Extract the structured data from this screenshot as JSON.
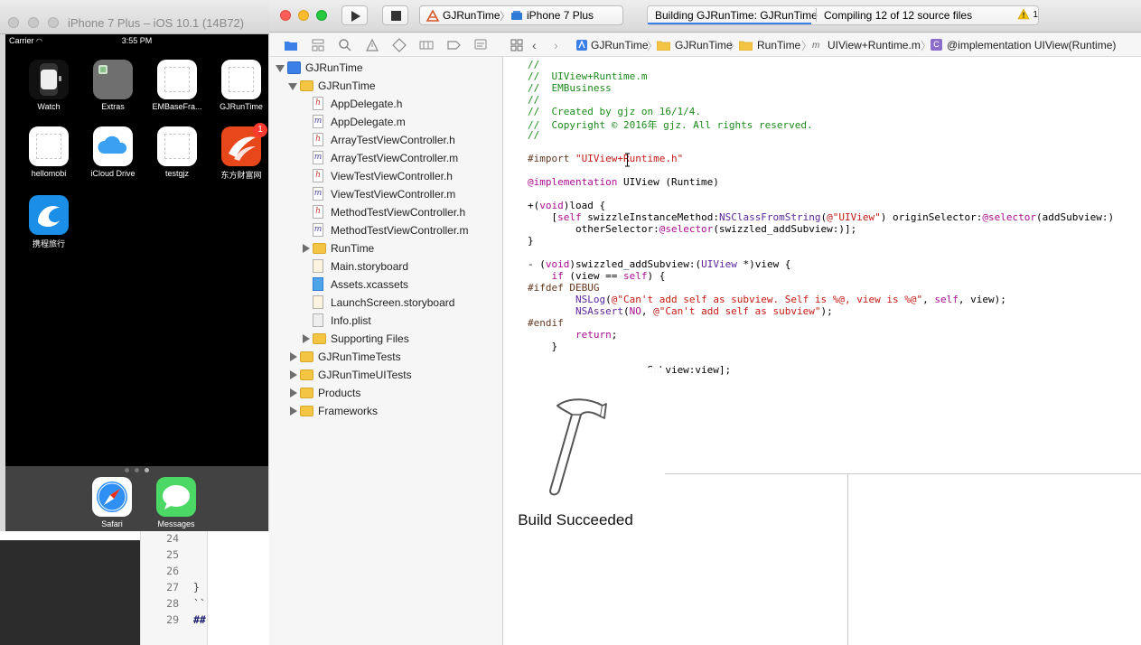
{
  "simulator": {
    "window_title": "iPhone 7 Plus – iOS 10.1 (14B72)",
    "status_bar": {
      "carrier": "Carrier",
      "time": "3:55 PM"
    },
    "home_apps": [
      {
        "label": "Watch",
        "icon": "watch-icon"
      },
      {
        "label": "Extras",
        "icon": "folder-icon"
      },
      {
        "label": "EMBaseFra...",
        "icon": "blank-app-icon"
      },
      {
        "label": "GJRunTime",
        "icon": "blank-app-icon"
      },
      {
        "label": "hellomobi",
        "icon": "blank-app-icon"
      },
      {
        "label": "iCloud Drive",
        "icon": "cloud-icon"
      },
      {
        "label": "testgjz",
        "icon": "blank-app-icon"
      },
      {
        "label": "东方财富网",
        "icon": "eastmoney-icon",
        "badge": "1"
      },
      {
        "label": "携程旅行",
        "icon": "dolphin-icon"
      }
    ],
    "dock_apps": [
      {
        "label": "Safari",
        "icon": "compass-icon"
      },
      {
        "label": "Messages",
        "icon": "speech-bubble-icon"
      }
    ],
    "background_editor": {
      "line_numbers": [
        "24",
        "25",
        "26",
        "27",
        "28",
        "29"
      ],
      "code": [
        "",
        "",
        "",
        "}",
        "``",
        "##"
      ]
    }
  },
  "toolbar": {
    "scheme": "GJRunTime",
    "device": "iPhone 7 Plus",
    "activity_title": "Building GJRunTime: GJRunTime",
    "activity_status": "Compiling 12 of 12 source files",
    "warning_count": "1",
    "build_progress": 0.42
  },
  "navigator": {
    "tree": [
      {
        "label": "GJRunTime",
        "depth": 0,
        "kind": "project",
        "disclosure": "open"
      },
      {
        "label": "GJRunTime",
        "depth": 1,
        "kind": "folder",
        "disclosure": "open"
      },
      {
        "label": "AppDelegate.h",
        "depth": 2,
        "kind": "h"
      },
      {
        "label": "AppDelegate.m",
        "depth": 2,
        "kind": "m"
      },
      {
        "label": "ArrayTestViewController.h",
        "depth": 2,
        "kind": "h"
      },
      {
        "label": "ArrayTestViewController.m",
        "depth": 2,
        "kind": "m"
      },
      {
        "label": "ViewTestViewController.h",
        "depth": 2,
        "kind": "h"
      },
      {
        "label": "ViewTestViewController.m",
        "depth": 2,
        "kind": "m"
      },
      {
        "label": "MethodTestViewController.h",
        "depth": 2,
        "kind": "h"
      },
      {
        "label": "MethodTestViewController.m",
        "depth": 2,
        "kind": "m"
      },
      {
        "label": "RunTime",
        "depth": 2,
        "kind": "folder",
        "disclosure": "closed"
      },
      {
        "label": "Main.storyboard",
        "depth": 2,
        "kind": "storyboard"
      },
      {
        "label": "Assets.xcassets",
        "depth": 2,
        "kind": "assets"
      },
      {
        "label": "LaunchScreen.storyboard",
        "depth": 2,
        "kind": "storyboard"
      },
      {
        "label": "Info.plist",
        "depth": 2,
        "kind": "plist"
      },
      {
        "label": "Supporting Files",
        "depth": 2,
        "kind": "folder",
        "disclosure": "closed"
      },
      {
        "label": "GJRunTimeTests",
        "depth": 1,
        "kind": "folder",
        "disclosure": "closed"
      },
      {
        "label": "GJRunTimeUITests",
        "depth": 1,
        "kind": "folder",
        "disclosure": "closed"
      },
      {
        "label": "Products",
        "depth": 1,
        "kind": "folder",
        "disclosure": "closed"
      },
      {
        "label": "Frameworks",
        "depth": 1,
        "kind": "folder",
        "disclosure": "closed"
      }
    ]
  },
  "jumpbar": {
    "items": [
      "GJRunTime",
      "GJRunTime",
      "RunTime",
      "UIView+Runtime.m",
      "@implementation UIView(Runtime)"
    ]
  },
  "editor": {
    "lines": [
      [
        [
          "c-com",
          "//"
        ]
      ],
      [
        [
          "c-com",
          "//  UIView+Runtime.m"
        ]
      ],
      [
        [
          "c-com",
          "//  EMBusiness"
        ]
      ],
      [
        [
          "c-com",
          "//"
        ]
      ],
      [
        [
          "c-com",
          "//  Created by gjz on 16/1/4."
        ]
      ],
      [
        [
          "c-com",
          "//  Copyright © 2016年 gjz. All rights reserved."
        ]
      ],
      [
        [
          "c-com",
          "//"
        ]
      ],
      [],
      [
        [
          "c-pp",
          "#import "
        ],
        [
          "c-str",
          "\"UIView+Runtime.h\""
        ]
      ],
      [],
      [
        [
          "c-kw",
          "@implementation "
        ],
        [
          "",
          "UIView (Runtime)"
        ]
      ],
      [],
      [
        [
          "",
          "+("
        ],
        [
          "c-kw",
          "void"
        ],
        [
          "",
          ")load {"
        ]
      ],
      [
        [
          "",
          "    ["
        ],
        [
          "c-kw",
          "self"
        ],
        [
          "",
          " swizzleInstanceMethod:"
        ],
        [
          "c-cls",
          "NSClassFromString"
        ],
        [
          "",
          "("
        ],
        [
          "c-str",
          "@\"UIView\""
        ],
        [
          "",
          ") originSelector:"
        ],
        [
          "c-kw",
          "@selector"
        ],
        [
          "",
          "(addSubview:)"
        ]
      ],
      [
        [
          "",
          "        otherSelector:"
        ],
        [
          "c-kw",
          "@selector"
        ],
        [
          "",
          "(swizzled_addSubview:)];"
        ]
      ],
      [
        [
          "",
          "}"
        ]
      ],
      [],
      [
        [
          "",
          "- ("
        ],
        [
          "c-kw",
          "void"
        ],
        [
          "",
          ")swizzled_addSubview:("
        ],
        [
          "c-cls",
          "UIView"
        ],
        [
          "",
          " *)view {"
        ]
      ],
      [
        [
          "",
          "    "
        ],
        [
          "c-kw",
          "if"
        ],
        [
          "",
          " (view == "
        ],
        [
          "c-kw",
          "self"
        ],
        [
          "",
          ") {"
        ]
      ],
      [
        [
          "c-pp",
          "#ifdef DEBUG"
        ]
      ],
      [
        [
          "",
          "        "
        ],
        [
          "c-cls",
          "NSLog"
        ],
        [
          "",
          "("
        ],
        [
          "c-str",
          "@\"Can't add self as subview. Self is %@, view is %@\""
        ],
        [
          "",
          ", "
        ],
        [
          "c-kw",
          "self"
        ],
        [
          "",
          ", view);"
        ]
      ],
      [
        [
          "",
          "        "
        ],
        [
          "c-cls",
          "NSAssert"
        ],
        [
          "",
          "("
        ],
        [
          "c-kw",
          "NO"
        ],
        [
          "",
          ", "
        ],
        [
          "c-str",
          "@\"Can't add self as subview\""
        ],
        [
          "",
          ");"
        ]
      ],
      [
        [
          "c-pp",
          "#endif"
        ]
      ],
      [
        [
          "",
          "        "
        ],
        [
          "c-kw",
          "return"
        ],
        [
          "",
          ";"
        ]
      ],
      [
        [
          "",
          "    }"
        ]
      ],
      [],
      [
        [
          "",
          "                    Subview:view];"
        ]
      ]
    ]
  },
  "build_hud": {
    "message": "Build Succeeded",
    "icon": "hammer-icon"
  },
  "colors": {
    "accent": "#3b80e6",
    "comment": "#1d8b1d",
    "string": "#c41a16",
    "keyword": "#aa0d91",
    "warning": "#f5c400"
  }
}
